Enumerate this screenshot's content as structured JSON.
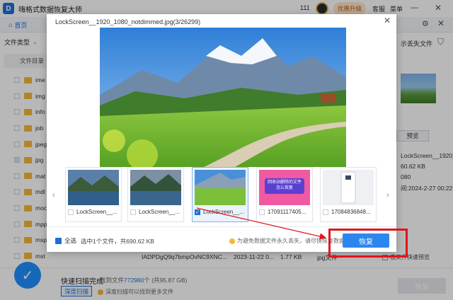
{
  "app": {
    "title": "嗨格式数据恢复大师",
    "count": "111",
    "upgrade_label": "优惠升级",
    "service_label": "客服",
    "menu_label": "菜单",
    "home_tab": "首页"
  },
  "sidebar": {
    "file_type_label": "文件类型",
    "file_dir_label": "文件目录",
    "items": [
      {
        "label": "ime"
      },
      {
        "label": "img"
      },
      {
        "label": "info"
      },
      {
        "label": "job"
      },
      {
        "label": "jpeg"
      },
      {
        "label": "jpg"
      },
      {
        "label": "mat"
      },
      {
        "label": "mdl"
      },
      {
        "label": "moc"
      },
      {
        "label": "mpp"
      },
      {
        "label": "msp"
      },
      {
        "label": "mst"
      }
    ]
  },
  "right_panel": {
    "lost_files_label": "示丢失文件",
    "preview_label": "预览",
    "file_name": "LockScreen__1920_1",
    "file_size": "60.62 KB",
    "file_dims": "080",
    "file_date": "间:2024-2-27 00:22:",
    "quick_preview_label": "击文件快速预览"
  },
  "bg_row": {
    "name": "IADPDgQ9q7bmpOvNC9XNC...",
    "date": "2023-11-22 0...",
    "size": "1.77 KB",
    "type": "jpg文件"
  },
  "footer": {
    "scan_done": "快速扫描完成",
    "found_prefix": "找到文件",
    "found_count": "772980",
    "found_suffix": "个 (共95.87 GB)",
    "deep_scan_label": "深度扫描",
    "deep_scan_hint": "深度扫描可以找到更多文件",
    "recover_label": "恢复"
  },
  "modal": {
    "title": "LockScreen__1920_1080_notdimmed.jpg(3/26299)",
    "thumbs": [
      {
        "label": "LockScreen__..."
      },
      {
        "label": "LockScreen__..."
      },
      {
        "label": "LockScreen__..."
      },
      {
        "label": "17091117405..."
      },
      {
        "label": "17084836848..."
      }
    ],
    "thumb_poster_text": "回收站删除的文件怎么恢复",
    "select_all_label": "全选",
    "selected_info": "选中1个文件，共690.62 KB",
    "warning": "为避免数据文件永久丢失，请尽快恢复数据",
    "recover_label": "恢复"
  },
  "colors": {
    "brand": "#1f6fd6",
    "recover_button": "#2d86f0",
    "annotation_red": "#e1141c"
  }
}
